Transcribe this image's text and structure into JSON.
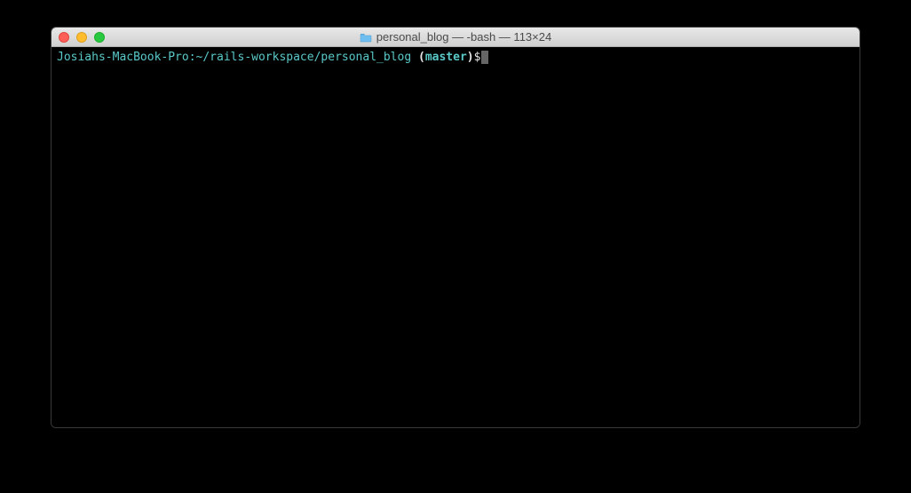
{
  "window": {
    "title": "personal_blog — -bash — 113×24"
  },
  "prompt": {
    "hostpath": "Josiahs-MacBook-Pro:~/rails-workspace/personal_blog ",
    "paren_open": "(",
    "branch": "master",
    "paren_close": ")",
    "dollar": "$"
  }
}
